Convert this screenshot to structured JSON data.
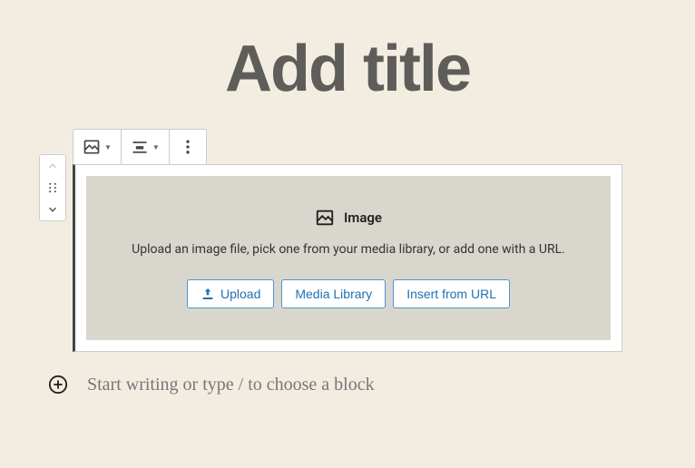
{
  "title": {
    "placeholder": "Add title"
  },
  "toolbar": {
    "block_type": "image-block",
    "align": "center"
  },
  "block": {
    "type_label": "Image",
    "description": "Upload an image file, pick one from your media library, or add one with a URL.",
    "buttons": {
      "upload": "Upload",
      "media_library": "Media Library",
      "insert_url": "Insert from URL"
    }
  },
  "appender": {
    "prompt": "Start writing or type / to choose a block"
  }
}
